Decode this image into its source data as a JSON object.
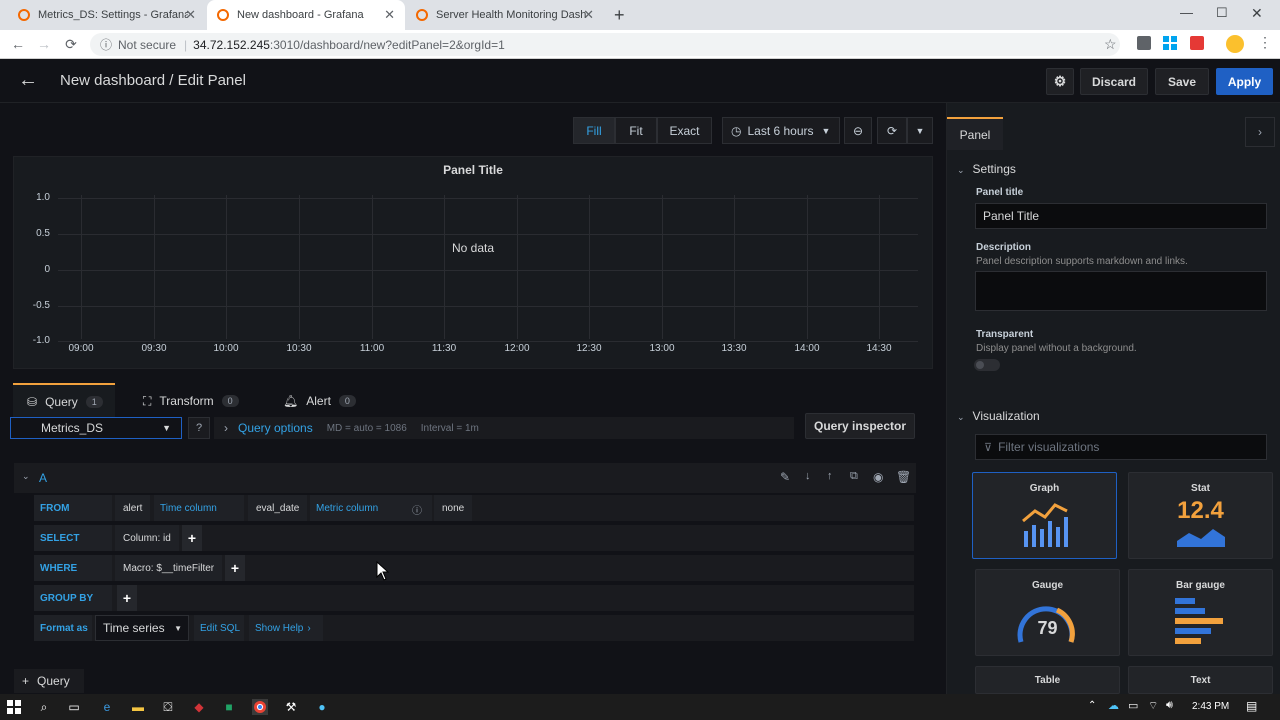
{
  "browser": {
    "tabs": [
      {
        "title": "Metrics_DS: Settings - Grafana",
        "active": false
      },
      {
        "title": "New dashboard - Grafana",
        "active": true
      },
      {
        "title": "Server Health Monitoring Dashb",
        "active": false
      }
    ],
    "security_label": "Not secure",
    "url_host": "34.72.152.245",
    "url_path": ":3010/dashboard/new?editPanel=2&orgId=1"
  },
  "header": {
    "title": "New dashboard / Edit Panel",
    "discard_label": "Discard",
    "save_label": "Save",
    "apply_label": "Apply"
  },
  "toolbar": {
    "fill_label": "Fill",
    "fit_label": "Fit",
    "exact_label": "Exact",
    "time_range_label": "Last 6 hours"
  },
  "graph": {
    "title": "Panel Title",
    "empty_message": "No data",
    "y_ticks": [
      "1.0",
      "0.5",
      "0",
      "-0.5",
      "-1.0"
    ],
    "x_ticks": [
      "09:00",
      "09:30",
      "10:00",
      "10:30",
      "11:00",
      "11:30",
      "12:00",
      "12:30",
      "13:00",
      "13:30",
      "14:00",
      "14:30"
    ]
  },
  "query_tabs": [
    {
      "label": "Query",
      "count": "1"
    },
    {
      "label": "Transform",
      "count": "0"
    },
    {
      "label": "Alert",
      "count": "0"
    }
  ],
  "query": {
    "datasource": "Metrics_DS",
    "options_label": "Query options",
    "md_info": "MD = auto = 1086",
    "interval_info": "Interval = 1m",
    "inspector_label": "Query inspector",
    "ref_id": "A",
    "from_kw": "FROM",
    "from_table": "alert",
    "time_column_kw": "Time column",
    "time_column_value": "eval_date",
    "metric_column_kw": "Metric column",
    "metric_column_value": "none",
    "select_kw": "SELECT",
    "select_value": "Column: id",
    "where_kw": "WHERE",
    "where_value": "Macro: $__timeFilter",
    "group_by_kw": "GROUP BY",
    "format_kw": "Format as",
    "format_value": "Time series",
    "edit_sql_label": "Edit SQL",
    "show_help_label": "Show Help",
    "add_query_label": "Query"
  },
  "side_panel": {
    "tab_label": "Panel",
    "settings_heading": "Settings",
    "panel_title_label": "Panel title",
    "panel_title_value": "Panel Title",
    "description_label": "Description",
    "description_help": "Panel description supports markdown and links.",
    "transparent_label": "Transparent",
    "transparent_help": "Display panel without a background.",
    "visualization_heading": "Visualization",
    "filter_placeholder": "Filter visualizations",
    "viz": [
      {
        "label": "Graph"
      },
      {
        "label": "Stat",
        "value": "12.4"
      },
      {
        "label": "Gauge",
        "value": "79"
      },
      {
        "label": "Bar gauge"
      },
      {
        "label": "Table"
      },
      {
        "label": "Text"
      }
    ]
  },
  "taskbar": {
    "time": "2:43 PM"
  },
  "colors": {
    "primary_blue": "#1f60c4",
    "keyword_blue": "#33a2e5",
    "orange_accent": "#f2a13d"
  }
}
